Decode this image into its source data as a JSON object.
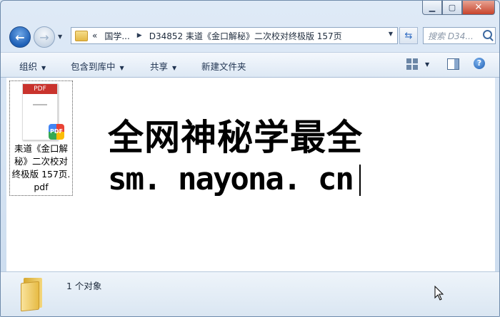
{
  "window": {
    "caption_buttons": {
      "minimize": "▁",
      "maximize": "▢",
      "close": "✕"
    }
  },
  "nav": {
    "back_glyph": "←",
    "forward_glyph": "→",
    "dropdown_glyph": "▼",
    "breadcrumb": {
      "overflow": "«",
      "segments": [
        "国学...",
        "D34852 耒道《金口解秘》二次校对终极版 157页"
      ],
      "separator": "▶"
    },
    "refresh_glyph": "⇆",
    "search_placeholder": "搜索 D34..."
  },
  "toolbar": {
    "organize": "组织",
    "include_in_library": "包含到库中",
    "share": "共享",
    "new_folder": "新建文件夹",
    "dropdown_glyph": "▼",
    "help_glyph": "?"
  },
  "files": [
    {
      "badge_text": "PDF",
      "thumb_header": "PDF",
      "name_lines": [
        "耒道《金口解",
        "秘》二次校对",
        "终极版 157页.",
        "pdf"
      ]
    }
  ],
  "banner": {
    "line1": "全网神秘学最全",
    "line2": "sm. nayona. cn"
  },
  "details": {
    "count_text": "1 个对象"
  }
}
